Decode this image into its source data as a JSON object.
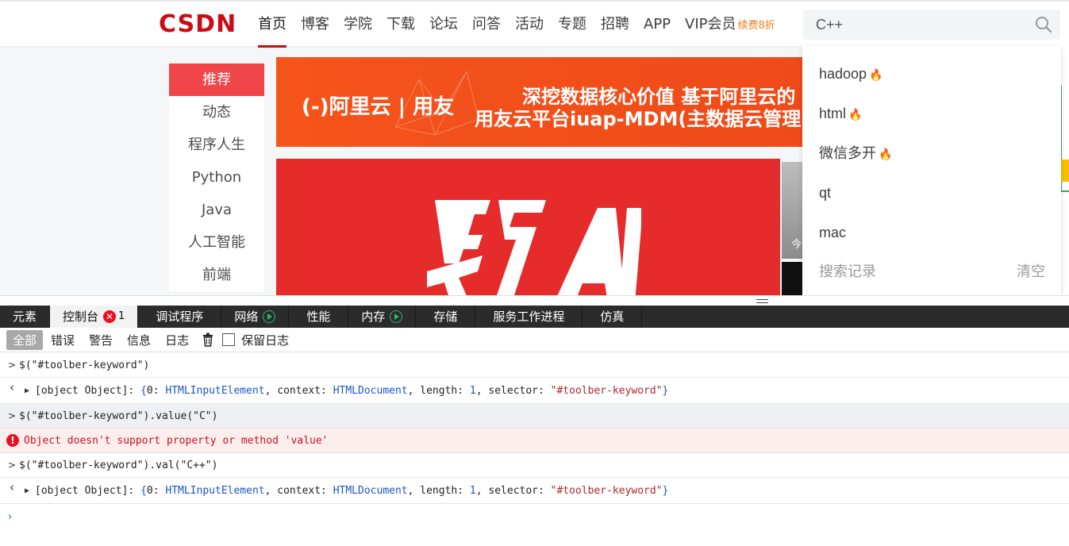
{
  "site": {
    "logo": "CSDN",
    "nav": [
      "首页",
      "博客",
      "学院",
      "下载",
      "论坛",
      "问答",
      "活动",
      "专题",
      "招聘",
      "APP",
      "VIP会员"
    ],
    "vip_sub": "续费8折",
    "search": {
      "value": "C++"
    },
    "categories": [
      "推荐",
      "动态",
      "程序人生",
      "Python",
      "Java",
      "人工智能",
      "前端"
    ],
    "banner1": {
      "logo": "(-)阿里云 | 用友",
      "line1": "深挖数据核心价值  基于阿里云的",
      "line2": "用友云平台iuap-MDM(主数据云管理"
    },
    "banner2": {
      "art_text": "百万人学AI"
    },
    "side_thumb_text": "今",
    "suggestions": [
      {
        "label": "hadoop",
        "hot": true
      },
      {
        "label": "html",
        "hot": true
      },
      {
        "label": "微信多开",
        "hot": true
      },
      {
        "label": "qt",
        "hot": false
      },
      {
        "label": "mac",
        "hot": false
      }
    ],
    "history_label": "搜索记录",
    "clear_label": "清空"
  },
  "devtools": {
    "tabs": [
      {
        "label": "元素"
      },
      {
        "label": "控制台",
        "error_count": "1"
      },
      {
        "label": "调试程序"
      },
      {
        "label": "网络"
      },
      {
        "label": "性能"
      },
      {
        "label": "内存"
      },
      {
        "label": "存储"
      },
      {
        "label": "服务工作进程"
      },
      {
        "label": "仿真"
      }
    ],
    "filters": [
      "全部",
      "错误",
      "警告",
      "信息",
      "日志"
    ],
    "preserve_log": "保留日志",
    "console": {
      "in1": "$(\"#toolber-keyword\")",
      "out_prefix": "[object Object]: ",
      "in2": "$(\"#toolber-keyword\").value(\"C\")",
      "error": "Object doesn't support property or method 'value'",
      "in3": "$(\"#toolber-keyword\").val(\"C++\")"
    }
  },
  "colors": {
    "brand_red": "#ca0c16",
    "menu_active": "#f0464a",
    "vip_orange": "#f67d1b",
    "devtools_bar": "#2b2b2b",
    "error_red": "#e81123"
  }
}
